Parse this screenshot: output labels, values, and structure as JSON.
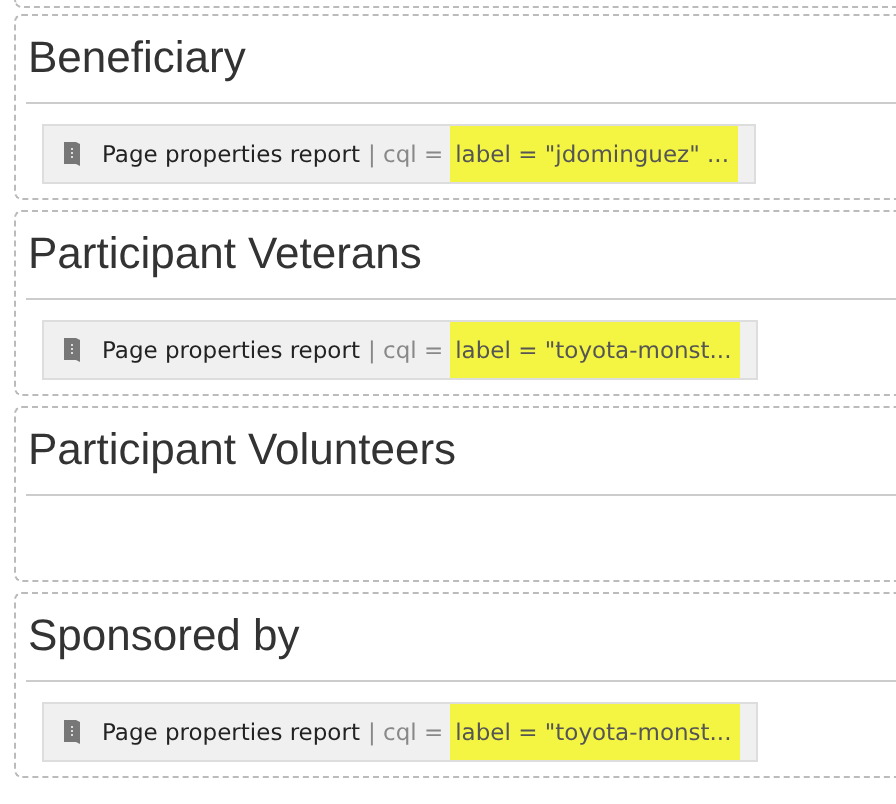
{
  "sections": [
    {
      "heading": "Beneficiary",
      "macro": {
        "title": "Page properties report",
        "separator": "| cql =",
        "query": "label = \"jdominguez\" ...",
        "highlighted": true
      }
    },
    {
      "heading": "Participant Veterans",
      "macro": {
        "title": "Page properties report",
        "separator": "| cql =",
        "query": "label = \"toyota-monst...",
        "highlighted": true
      }
    },
    {
      "heading": "Participant Volunteers"
    },
    {
      "heading": "Sponsored by",
      "macro": {
        "title": "Page properties report",
        "separator": "| cql =",
        "query": "label = \"toyota-monst...",
        "highlighted": true
      }
    }
  ]
}
